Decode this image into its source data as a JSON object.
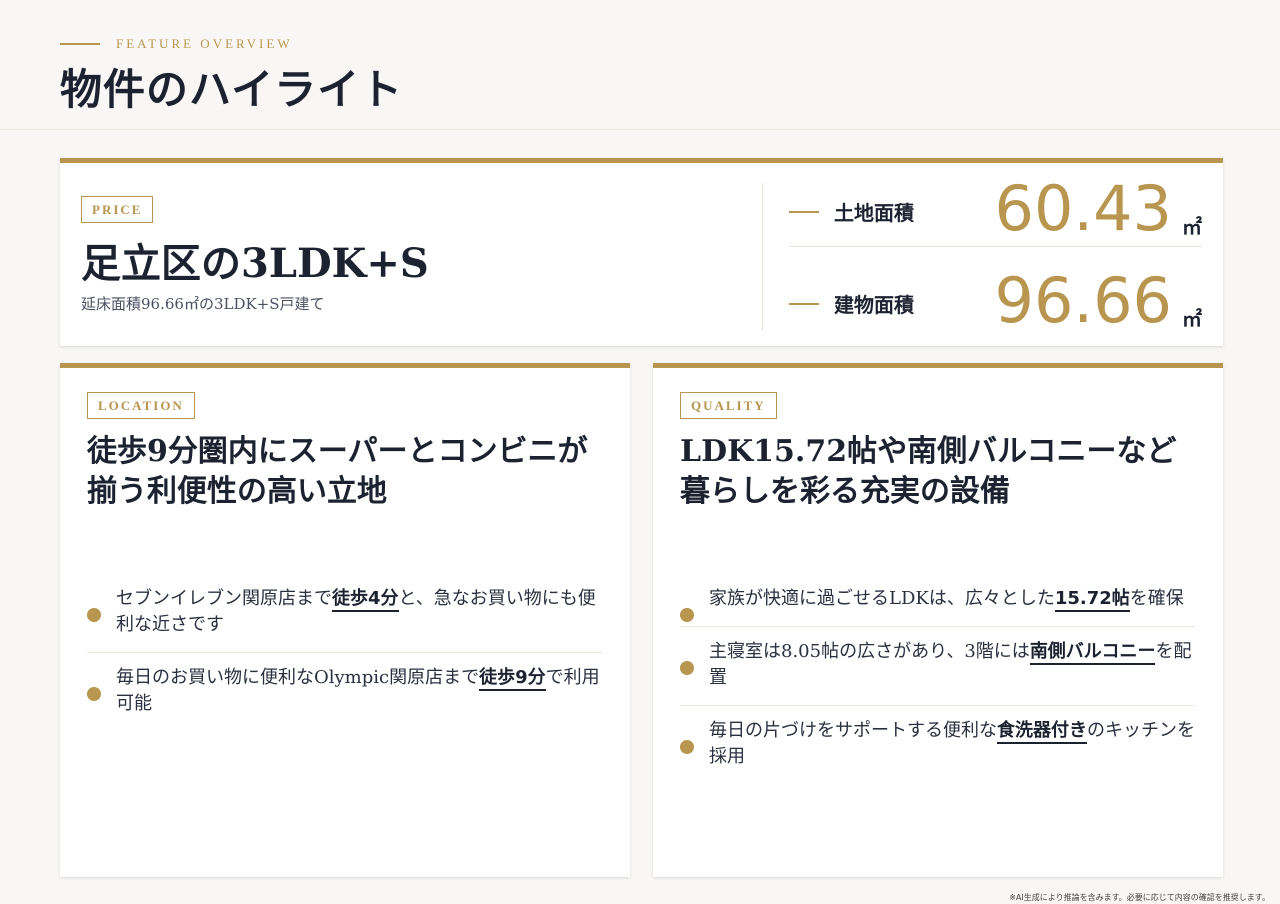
{
  "header": {
    "eyebrow": "FEATURE OVERVIEW",
    "title": "物件のハイライト"
  },
  "price_card": {
    "tag": "PRICE",
    "title": "足立区の3LDK+S",
    "subtitle": "延床面積96.66㎡の3LDK+S戸建て",
    "stats": [
      {
        "label": "土地面積",
        "value": "60.43",
        "unit": "㎡"
      },
      {
        "label": "建物面積",
        "value": "96.66",
        "unit": "㎡"
      }
    ]
  },
  "location_card": {
    "tag": "LOCATION",
    "title_line1": "徒歩9分圏内にスーパーとコンビニが",
    "title_line2": "揃う利便性の高い立地",
    "bullets": [
      {
        "pre": "セブンイレブン関原店まで",
        "highlight": "徒歩4分",
        "post": "と、急なお買い物にも便利な近さです"
      },
      {
        "pre": "毎日のお買い物に便利なOlympic関原店まで",
        "highlight": "徒歩9分",
        "post": "で利用可能"
      }
    ]
  },
  "quality_card": {
    "tag": "QUALITY",
    "title_line1": "LDK15.72帖や南側バルコニーなど",
    "title_line2": "暮らしを彩る充実の設備",
    "bullets": [
      {
        "pre": "家族が快適に過ごせるLDKは、広々とした",
        "highlight": "15.72帖",
        "post": "を確保"
      },
      {
        "pre": "主寝室は8.05帖の広さがあり、3階には",
        "highlight": "南側バルコニー",
        "post": "を配置"
      },
      {
        "pre": "毎日の片づけをサポートする便利な",
        "highlight": "食洗器付き",
        "post": "のキッチンを採用"
      }
    ]
  },
  "footnote": "※AI生成により推論を含みます。必要に応じて内容の確認を推奨します。",
  "colors": {
    "accent": "#b8964f",
    "text": "#1c2230",
    "background": "#f8f7f5"
  }
}
